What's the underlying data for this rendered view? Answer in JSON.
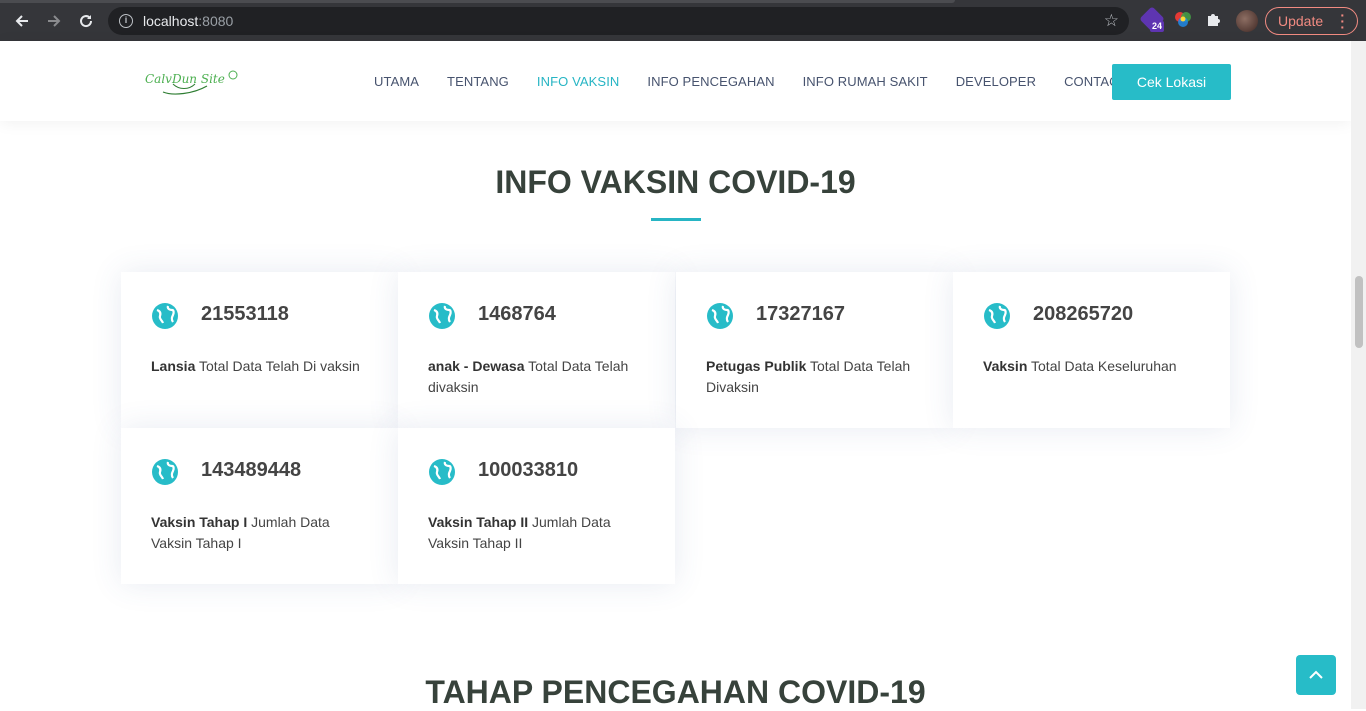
{
  "browser": {
    "url_host": "localhost",
    "url_port": ":8080",
    "extension_badge": "24",
    "update_label": "Update"
  },
  "header": {
    "logo_text": "CalvDun Site",
    "nav": [
      "UTAMA",
      "TENTANG",
      "INFO VAKSIN",
      "INFO PENCEGAHAN",
      "INFO RUMAH SAKIT",
      "DEVELOPER",
      "CONTACT"
    ],
    "active_nav": "INFO VAKSIN",
    "cta_label": "Cek Lokasi"
  },
  "section": {
    "title": "INFO VAKSIN COVID-19",
    "cards": [
      {
        "number": "21553118",
        "label": "Lansia",
        "text": " Total Data Telah Di vaksin"
      },
      {
        "number": "1468764",
        "label": "anak - Dewasa",
        "text": " Total Data Telah divaksin"
      },
      {
        "number": "17327167",
        "label": "Petugas Publik",
        "text": " Total Data Telah Divaksin"
      },
      {
        "number": "208265720",
        "label": "Vaksin",
        "text": " Total Data Keseluruhan"
      },
      {
        "number": "143489448",
        "label": "Vaksin Tahap I",
        "text": " Jumlah Data Vaksin Tahap I"
      },
      {
        "number": "100033810",
        "label": "Vaksin Tahap II",
        "text": " Jumlah Data Vaksin Tahap II"
      }
    ]
  },
  "next_section": {
    "title": "TAHAP PENCEGAHAN COVID-19"
  },
  "colors": {
    "accent": "#27b5c4",
    "heading": "#37423b",
    "chrome": "#35363a"
  }
}
